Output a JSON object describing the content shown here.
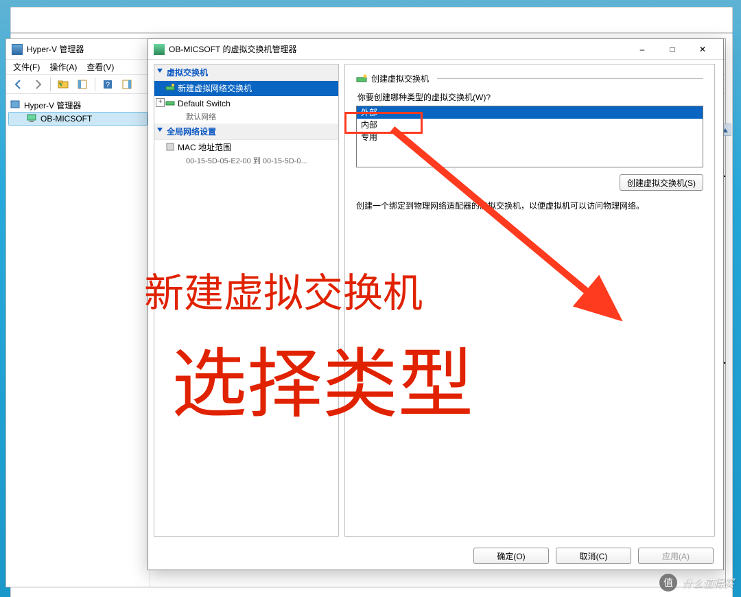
{
  "desktop": {
    "bg": "windows-default"
  },
  "hyperv_window": {
    "title": "Hyper-V 管理器",
    "menu": {
      "file": "文件(F)",
      "action": "操作(A)",
      "view": "查看(V)"
    },
    "tree": {
      "root": "Hyper-V 管理器",
      "node": "OB-MICSOFT"
    }
  },
  "dialog": {
    "title": "OB-MICSOFT 的虚拟交换机管理器",
    "left": {
      "group1": "虚拟交换机",
      "item1": "新建虚拟网络交换机",
      "item2": "Default Switch",
      "item2_sub": "默认网络",
      "group2": "全局网络设置",
      "item3": "MAC 地址范围",
      "item3_sub": "00-15-5D-05-E2-00 到 00-15-5D-0..."
    },
    "right": {
      "section_title": "创建虚拟交换机",
      "question": "你要创建哪种类型的虚拟交换机(W)?",
      "options": [
        "外部",
        "内部",
        "专用"
      ],
      "create_btn": "创建虚拟交换机(S)",
      "description": "创建一个绑定到物理网络适配器的虚拟交换机，以便虚拟机可以访问物理网络。"
    },
    "footer": {
      "ok": "确定(O)",
      "cancel": "取消(C)",
      "apply": "应用(A)"
    },
    "win_controls": {
      "min": "–",
      "max": "□",
      "close": "✕"
    }
  },
  "annotations": {
    "line1": "新建虚拟交换机",
    "line2": "选择类型"
  },
  "watermark": {
    "badge": "值",
    "text": "什么值得买"
  }
}
